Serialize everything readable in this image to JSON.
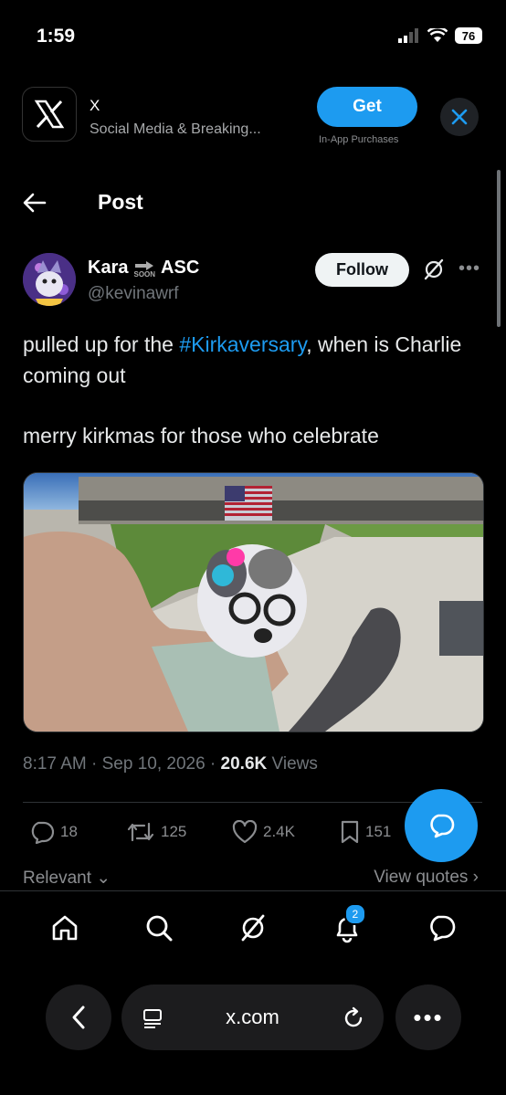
{
  "status": {
    "time": "1:59",
    "battery": "76"
  },
  "banner": {
    "app_name": "X",
    "subtitle": "Social Media & Breaking...",
    "get_label": "Get",
    "iap_label": "In-App Purchases"
  },
  "header": {
    "title": "Post"
  },
  "author": {
    "name_first": "Kara",
    "soon_label": "SOON",
    "name_last": "ASC",
    "handle": "@kevinawrf",
    "follow_label": "Follow"
  },
  "tweet": {
    "text_before": "pulled up for the ",
    "hashtag": "#Kirkaversary",
    "text_after": ", when is Charlie coming out",
    "line2": "merry kirkmas for those who celebrate",
    "time": "8:17 AM",
    "date": "Sep 10, 2026",
    "views_count": "20.6K",
    "views_label": "Views"
  },
  "actions": {
    "replies": "18",
    "reposts": "125",
    "likes": "2.4K",
    "bookmarks": "151"
  },
  "footer": {
    "relevant_label": "Relevant",
    "view_quotes_label": "View quotes"
  },
  "nav": {
    "notifications_badge": "2"
  },
  "browser": {
    "url": "x.com"
  },
  "colors": {
    "accent": "#1d9bf0",
    "background": "#000000",
    "muted": "#71767b"
  },
  "icons": [
    "x-logo-icon",
    "close-icon",
    "back-arrow-icon",
    "grok-icon",
    "more-icon",
    "reply-icon",
    "repost-icon",
    "like-icon",
    "bookmark-icon",
    "compose-icon",
    "home-icon",
    "search-icon",
    "bell-icon",
    "messages-icon",
    "reader-icon",
    "reload-icon"
  ]
}
